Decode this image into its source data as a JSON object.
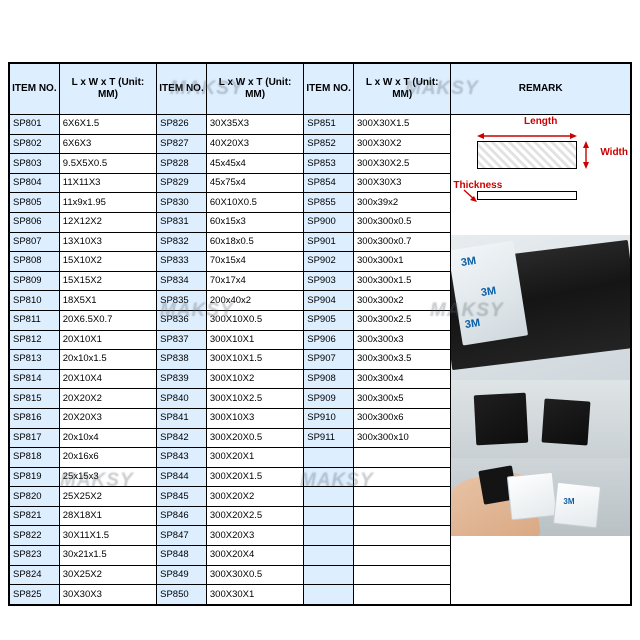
{
  "table": {
    "headers": {
      "item_no": "ITEM NO.",
      "dim": "L x W x T (Unit: MM)",
      "remark": "REMARK"
    },
    "groups": [
      {
        "rows": [
          {
            "item": "SP801",
            "dim": "6X6X1.5"
          },
          {
            "item": "SP802",
            "dim": "6X6X3"
          },
          {
            "item": "SP803",
            "dim": "9.5X5X0.5"
          },
          {
            "item": "SP804",
            "dim": "11X11X3"
          },
          {
            "item": "SP805",
            "dim": "11x9x1.95"
          },
          {
            "item": "SP806",
            "dim": "12X12X2"
          },
          {
            "item": "SP807",
            "dim": "13X10X3"
          },
          {
            "item": "SP808",
            "dim": "15X10X2"
          },
          {
            "item": "SP809",
            "dim": "15X15X2"
          },
          {
            "item": "SP810",
            "dim": "18X5X1"
          },
          {
            "item": "SP811",
            "dim": "20X6.5X0.7"
          },
          {
            "item": "SP812",
            "dim": "20X10X1"
          },
          {
            "item": "SP813",
            "dim": "20x10x1.5"
          },
          {
            "item": "SP814",
            "dim": "20X10X4"
          },
          {
            "item": "SP815",
            "dim": "20X20X2"
          },
          {
            "item": "SP816",
            "dim": "20X20X3"
          },
          {
            "item": "SP817",
            "dim": "20x10x4"
          },
          {
            "item": "SP818",
            "dim": "20x16x6"
          },
          {
            "item": "SP819",
            "dim": "25x15x3"
          },
          {
            "item": "SP820",
            "dim": "25X25X2"
          },
          {
            "item": "SP821",
            "dim": "28X18X1"
          },
          {
            "item": "SP822",
            "dim": "30X11X1.5"
          },
          {
            "item": "SP823",
            "dim": "30x21x1.5"
          },
          {
            "item": "SP824",
            "dim": "30X25X2"
          },
          {
            "item": "SP825",
            "dim": "30X30X3"
          }
        ]
      },
      {
        "rows": [
          {
            "item": "SP826",
            "dim": "30X35X3"
          },
          {
            "item": "SP827",
            "dim": "40X20X3"
          },
          {
            "item": "SP828",
            "dim": "45x45x4"
          },
          {
            "item": "SP829",
            "dim": "45x75x4"
          },
          {
            "item": "SP830",
            "dim": "60X10X0.5"
          },
          {
            "item": "SP831",
            "dim": "60x15x3"
          },
          {
            "item": "SP832",
            "dim": "60x18x0.5"
          },
          {
            "item": "SP833",
            "dim": "70x15x4"
          },
          {
            "item": "SP834",
            "dim": "70x17x4"
          },
          {
            "item": "SP835",
            "dim": "200x40x2"
          },
          {
            "item": "SP836",
            "dim": "300X10X0.5"
          },
          {
            "item": "SP837",
            "dim": "300X10X1"
          },
          {
            "item": "SP838",
            "dim": "300X10X1.5"
          },
          {
            "item": "SP839",
            "dim": "300X10X2"
          },
          {
            "item": "SP840",
            "dim": "300X10X2.5"
          },
          {
            "item": "SP841",
            "dim": "300X10X3"
          },
          {
            "item": "SP842",
            "dim": "300X20X0.5"
          },
          {
            "item": "SP843",
            "dim": "300X20X1"
          },
          {
            "item": "SP844",
            "dim": "300X20X1.5"
          },
          {
            "item": "SP845",
            "dim": "300X20X2"
          },
          {
            "item": "SP846",
            "dim": "300X20X2.5"
          },
          {
            "item": "SP847",
            "dim": "300X20X3"
          },
          {
            "item": "SP848",
            "dim": "300X20X4"
          },
          {
            "item": "SP849",
            "dim": "300X30X0.5"
          },
          {
            "item": "SP850",
            "dim": "300X30X1"
          }
        ]
      },
      {
        "rows": [
          {
            "item": "SP851",
            "dim": "300X30X1.5"
          },
          {
            "item": "SP852",
            "dim": "300X30X2"
          },
          {
            "item": "SP853",
            "dim": "300X30X2.5"
          },
          {
            "item": "SP854",
            "dim": "300X30X3"
          },
          {
            "item": "SP855",
            "dim": "300x39x2"
          },
          {
            "item": "SP900",
            "dim": "300x300x0.5"
          },
          {
            "item": "SP901",
            "dim": "300x300x0.7"
          },
          {
            "item": "SP902",
            "dim": "300x300x1"
          },
          {
            "item": "SP903",
            "dim": "300x300x1.5"
          },
          {
            "item": "SP904",
            "dim": "300x300x2"
          },
          {
            "item": "SP905",
            "dim": "300x300x2.5"
          },
          {
            "item": "SP906",
            "dim": "300x300x3"
          },
          {
            "item": "SP907",
            "dim": "300x300x3.5"
          },
          {
            "item": "SP908",
            "dim": "300x300x4"
          },
          {
            "item": "SP909",
            "dim": "300x300x5"
          },
          {
            "item": "SP910",
            "dim": "300x300x6"
          },
          {
            "item": "SP911",
            "dim": "300x300x10"
          },
          {
            "item": "",
            "dim": ""
          },
          {
            "item": "",
            "dim": ""
          },
          {
            "item": "",
            "dim": ""
          },
          {
            "item": "",
            "dim": ""
          },
          {
            "item": "",
            "dim": ""
          },
          {
            "item": "",
            "dim": ""
          },
          {
            "item": "",
            "dim": ""
          },
          {
            "item": "",
            "dim": ""
          }
        ]
      }
    ]
  },
  "remark": {
    "length_label": "Length",
    "width_label": "Width",
    "thickness_label": "Thickness",
    "brand_logo": "3M",
    "watermark": "MAKSY"
  },
  "colors": {
    "header_fill": "#ddeeff",
    "label_red": "#cc0000",
    "brand_blue": "#0b5fa5"
  }
}
